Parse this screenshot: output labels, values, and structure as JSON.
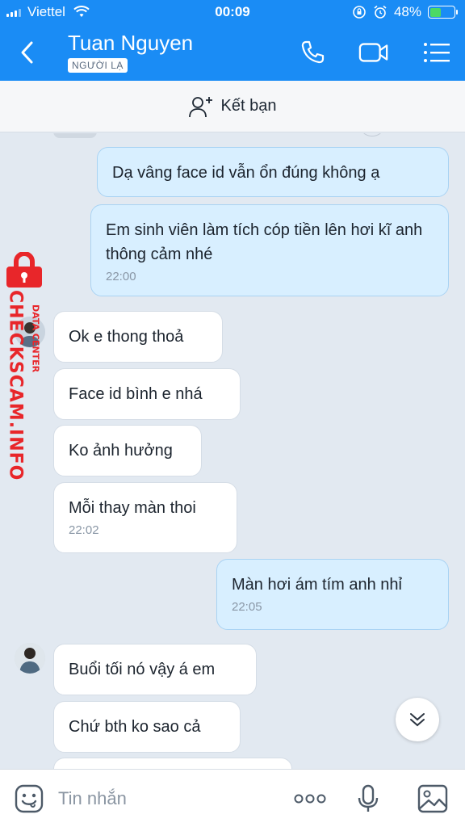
{
  "status_bar": {
    "carrier": "Viettel",
    "time": "00:09",
    "battery": "48%"
  },
  "header": {
    "contact_name": "Tuan Nguyen",
    "badge": "NGƯỜI LẠ",
    "icons": [
      "back-icon",
      "phone-icon",
      "video-call-icon",
      "menu-icon"
    ]
  },
  "add_friend": {
    "label": "Kết bạn"
  },
  "messages": [
    {
      "from": "me",
      "text": "Dạ vâng face id vẫn ổn đúng không ạ"
    },
    {
      "from": "me",
      "text": "Em sinh viên làm tích cóp tiền lên hơi kĩ anh thông cảm nhé",
      "time": "22:00"
    },
    {
      "from": "them",
      "text": "Ok e thong thoả"
    },
    {
      "from": "them",
      "text": "Face id bình e nhá"
    },
    {
      "from": "them",
      "text": "Ko ảnh hưởng"
    },
    {
      "from": "them",
      "text": "Mỗi thay màn thoi",
      "time": "22:02"
    },
    {
      "from": "me",
      "text": "Màn hơi ám tím anh nhỉ",
      "time": "22:05"
    },
    {
      "from": "them",
      "text": "Buổi tối nó vậy á em"
    },
    {
      "from": "them",
      "text": "Chứ bth ko sao cả"
    }
  ],
  "watermark": {
    "brand": "CHECKSCAM.INFO",
    "sub": "DATA CENTER",
    "color": "#e8262a"
  },
  "composer": {
    "placeholder": "Tin nhắn"
  },
  "colors": {
    "header_blue": "#1a8cf5",
    "my_bubble": "#d8efff",
    "their_bubble": "#ffffff",
    "chat_bg": "#e2e9f1"
  }
}
